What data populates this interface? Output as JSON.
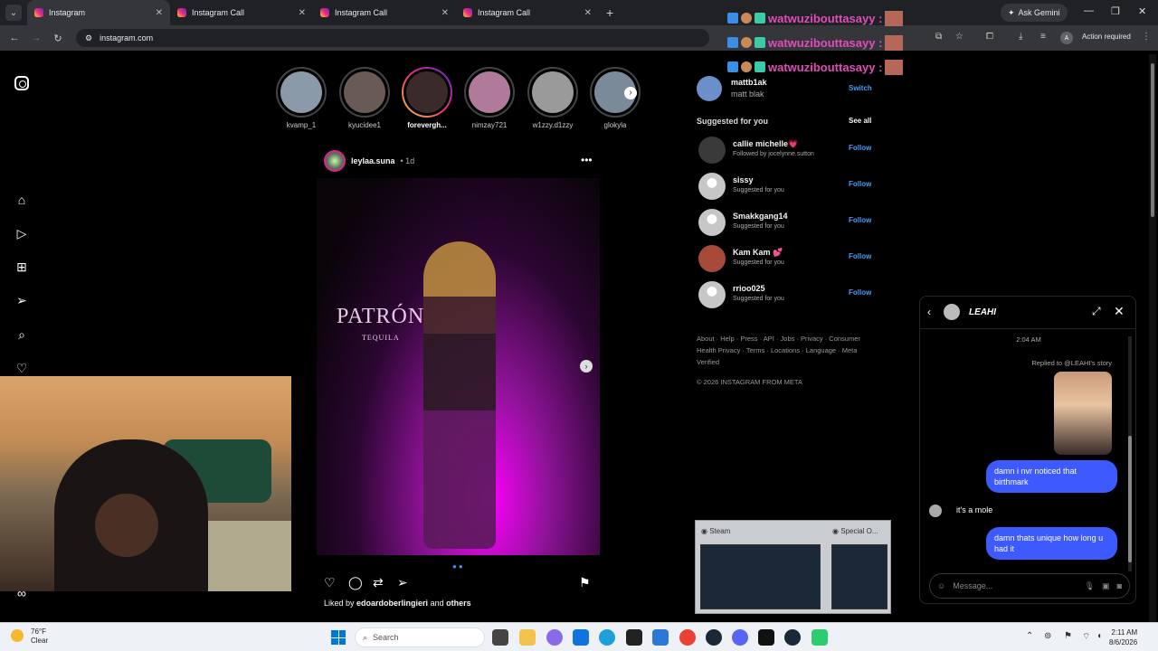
{
  "browser": {
    "tabs": [
      {
        "label": "Instagram",
        "active": true
      },
      {
        "label": "Instagram Call",
        "active": false
      },
      {
        "label": "Instagram Call",
        "active": false
      },
      {
        "label": "Instagram Call",
        "active": false
      }
    ],
    "ask_gemini": "Ask Gemini",
    "url": "instagram.com",
    "action_required": "Action required",
    "profile_initial": "A"
  },
  "stream_chat": {
    "lines": [
      "watwuzibouttasayy :",
      "watwuzibouttasayy :",
      "watwuzibouttasayy :"
    ],
    "color": "#e04dbb"
  },
  "stories": [
    {
      "name": "kvamp_1",
      "seen": true,
      "color": "#8a9aa8"
    },
    {
      "name": "kyucidee1",
      "seen": true,
      "color": "#6a5a55"
    },
    {
      "name": "foreverghost",
      "display": "forevergh...",
      "seen": false,
      "color": "#3a2a2a"
    },
    {
      "name": "nimzay721",
      "seen": true,
      "color": "#b07a9a"
    },
    {
      "name": "w1zzy.d1zzy",
      "seen": true,
      "color": "#9a9a9a"
    },
    {
      "name": "glokyla",
      "seen": true,
      "color": "#7a8a98"
    }
  ],
  "post": {
    "username": "leylaa.suna",
    "age": "• 1d",
    "brand_text": "PATRÓN",
    "brand_sub": "TEQUILA",
    "liked_prefix": "Liked by",
    "liked_user": "edoardoberlingieri",
    "liked_and": "and",
    "liked_others": "others"
  },
  "account": {
    "username": "mattb1ak",
    "name": "matt blak",
    "switch": "Switch"
  },
  "suggestions": {
    "heading": "Suggested for you",
    "see_all": "See all",
    "items": [
      {
        "username": "callie michelle💗",
        "sub": "Followed by jocelynne.sutton",
        "follow": "Follow"
      },
      {
        "username": "sissy",
        "sub": "Suggested for you",
        "follow": "Follow"
      },
      {
        "username": "Smakkgang14",
        "sub": "Suggested for you",
        "follow": "Follow"
      },
      {
        "username": "Kam Kam 💕",
        "sub": "Suggested for you",
        "follow": "Follow"
      },
      {
        "username": "rrioo025",
        "sub": "Suggested for you",
        "follow": "Follow"
      }
    ]
  },
  "footer": {
    "links": "About · Help · Press · API · Jobs · Privacy · Consumer Health Privacy · Terms · Locations · Language · Meta Verified",
    "copyright": "© 2026 INSTAGRAM FROM META"
  },
  "dm": {
    "name": "LEAHI",
    "time": "2:04 AM",
    "replied": "Replied to @LEAHI's story",
    "messages": [
      {
        "dir": "out",
        "text": "damn i nvr noticed that birthmark"
      },
      {
        "dir": "in",
        "text": "it's a mole"
      },
      {
        "dir": "out",
        "text": "damn thats unique how long u had it"
      }
    ],
    "placeholder": "Message..."
  },
  "taskbar_preview": {
    "items": [
      "Steam",
      "Special O..."
    ]
  },
  "taskbar": {
    "temp": "76°F",
    "condition": "Clear",
    "search": "Search",
    "time": "2:11 AM",
    "date": "8/6/2026"
  }
}
